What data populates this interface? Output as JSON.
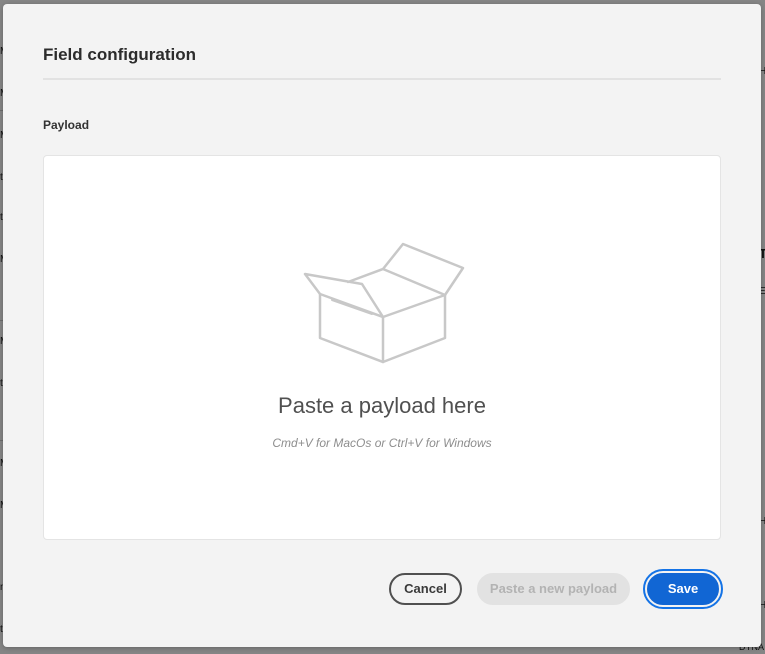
{
  "background": {
    "left_fragments": [
      "M",
      "M",
      "M",
      "ti",
      "ti",
      "M",
      "M",
      "ti",
      "M",
      "M",
      "n",
      "ti"
    ],
    "right_fragments": [
      "H",
      "T",
      "E",
      "I",
      "H",
      "H",
      "DYNA"
    ]
  },
  "dialog": {
    "title": "Field configuration",
    "section_label": "Payload",
    "dropzone": {
      "icon": "open-box-icon",
      "title": "Paste a payload here",
      "hint": "Cmd+V for MacOs or Ctrl+V for Windows"
    },
    "buttons": {
      "cancel_label": "Cancel",
      "paste_new_label": "Paste a new payload",
      "save_label": "Save"
    }
  },
  "colors": {
    "accent": "#1473e6",
    "primary_button": "#1166d4",
    "dialog_background": "#f3f3f3",
    "illustration_stroke": "#c8c8c8"
  }
}
